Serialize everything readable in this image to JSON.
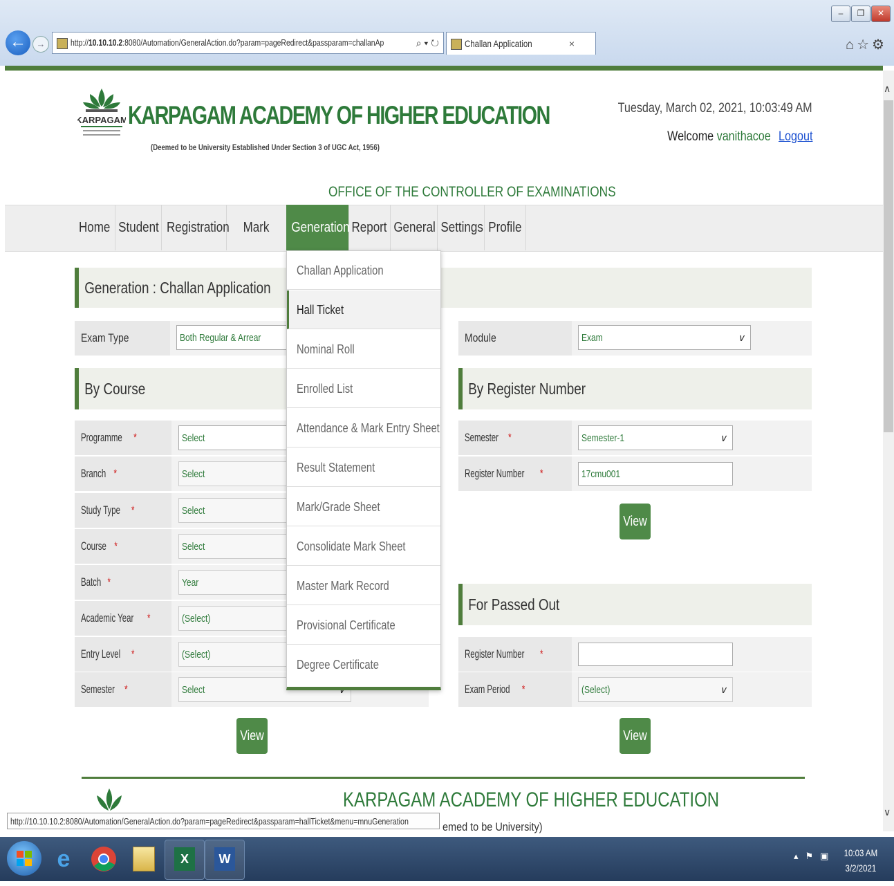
{
  "browser": {
    "url_prefix": "http://",
    "url_host": "10.10.10.2",
    "url_rest": ":8080/Automation/GeneralAction.do?param=pageRedirect&passparam=challanAp",
    "tab_title": "Challan Application",
    "tab_close": "×",
    "status_url": "http://10.10.10.2:8080/Automation/GeneralAction.do?param=pageRedirect&passparam=hallTicket&menu=mnuGeneration"
  },
  "header": {
    "title": "KARPAGAM ACADEMY OF HIGHER EDUCATION",
    "subtitle": "(Deemed to be University Established Under Section 3 of UGC Act, 1956)",
    "logo_text": "KARPAGAM",
    "datetime": "Tuesday, March 02, 2021, 10:03:49 AM",
    "welcome": "Welcome",
    "username": "vanithacoe",
    "logout": "Logout",
    "office": "OFFICE OF THE CONTROLLER OF EXAMINATIONS"
  },
  "nav": [
    "Home",
    "Student",
    "Registration",
    "Mark Entry",
    "Generation",
    "Report",
    "General",
    "Settings",
    "Profile"
  ],
  "dropdown": [
    "Challan Application",
    "Hall Ticket",
    "Nominal Roll",
    "Enrolled List",
    "Attendance & Mark Entry Sheet",
    "Result Statement",
    "Mark/Grade Sheet",
    "Consolidate Mark Sheet",
    "Master Mark Record",
    "Provisional Certificate",
    "Degree Certificate"
  ],
  "page": {
    "heading": "Generation : Challan Application",
    "exam_type_label": "Exam Type",
    "exam_type_value": "Both Regular & Arrear",
    "module_label": "Module",
    "module_value": "Exam"
  },
  "by_course": {
    "title": "By Course",
    "fields": [
      {
        "label": "Programme",
        "value": "Select"
      },
      {
        "label": "Branch",
        "value": "Select"
      },
      {
        "label": "Study Type",
        "value": "Select"
      },
      {
        "label": "Course",
        "value": "Select"
      },
      {
        "label": "Batch",
        "value": "Year"
      },
      {
        "label": "Academic Year",
        "value": "(Select)"
      },
      {
        "label": "Entry Level",
        "value": "(Select)"
      },
      {
        "label": "Semester",
        "value": "Select"
      }
    ],
    "view": "View"
  },
  "by_register": {
    "title": "By Register Number",
    "semester_label": "Semester",
    "semester_value": "Semester-1",
    "regno_label": "Register Number",
    "regno_value": "17cmu001",
    "view": "View"
  },
  "passed_out": {
    "title": "For Passed Out",
    "regno_label": "Register Number",
    "regno_value": "",
    "period_label": "Exam Period",
    "period_value": "(Select)",
    "view": "View"
  },
  "footer": {
    "title": "KARPAGAM ACADEMY OF HIGHER EDUCATION",
    "sub": "emed to be University)"
  },
  "taskbar": {
    "time": "10:03 AM",
    "date": "3/2/2021"
  }
}
